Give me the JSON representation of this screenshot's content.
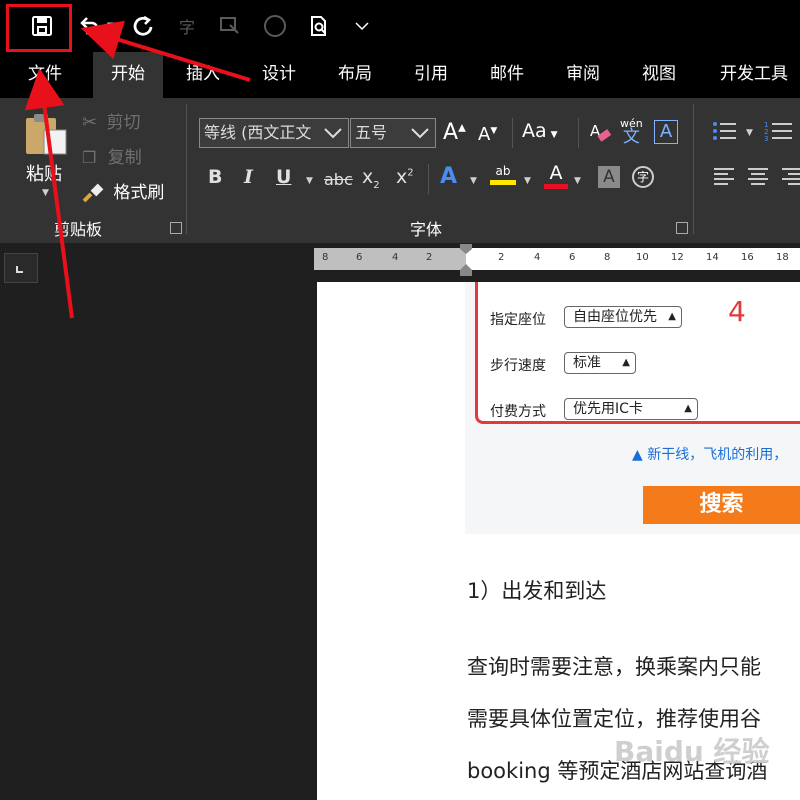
{
  "quick_access": {
    "save_icon": "save-icon",
    "undo_icon": "undo-icon",
    "redo_icon": "redo-icon"
  },
  "tabs": [
    {
      "label": "文件"
    },
    {
      "label": "开始"
    },
    {
      "label": "插入"
    },
    {
      "label": "设计"
    },
    {
      "label": "布局"
    },
    {
      "label": "引用"
    },
    {
      "label": "邮件"
    },
    {
      "label": "审阅"
    },
    {
      "label": "视图"
    },
    {
      "label": "开发工具"
    }
  ],
  "clipboard": {
    "paste": "粘贴",
    "cut": "剪切",
    "copy": "复制",
    "format_painter": "格式刷",
    "group_label": "剪贴板"
  },
  "font": {
    "font_name": "等线 (西文正文",
    "font_size": "五号",
    "grow": "A",
    "shrink": "A",
    "change_case": "Aa",
    "phonetic_top": "wén",
    "phonetic_bottom": "文",
    "char_border": "A",
    "bold": "B",
    "italic": "I",
    "underline": "U",
    "strike": "abc",
    "subscript": "x",
    "subscript_mark": "2",
    "superscript": "x",
    "superscript_mark": "2",
    "text_effects": "A",
    "highlight": "ab",
    "font_color": "A",
    "char_shading": "A",
    "enclose": "字",
    "group_label": "字体"
  },
  "ruler_ticks": [
    "8",
    "6",
    "4",
    "2",
    "2",
    "4",
    "6",
    "8",
    "10",
    "12",
    "14",
    "16",
    "18"
  ],
  "embedded_form": {
    "rows": [
      {
        "label": "指定座位",
        "value": "自由座位优先"
      },
      {
        "label": "步行速度",
        "value": "标准"
      },
      {
        "label": "付费方式",
        "value": "优先用IC卡"
      }
    ],
    "step_number": "4",
    "notice": "▲ 新干线，飞机的利用，",
    "search_button": "搜索"
  },
  "document": {
    "heading": "1）出发和到达",
    "line1": "查询时需要注意，换乘案内只能",
    "line2": "需要具体位置定位，推荐使用谷",
    "line3": "booking 等预定酒店网站查询酒"
  },
  "watermark": "Baidu 经验",
  "colors": {
    "annotation_red": "#e8101a",
    "highlight_yellow": "#ffe600",
    "font_color_red": "#e81123",
    "search_orange": "#f47a1a"
  }
}
